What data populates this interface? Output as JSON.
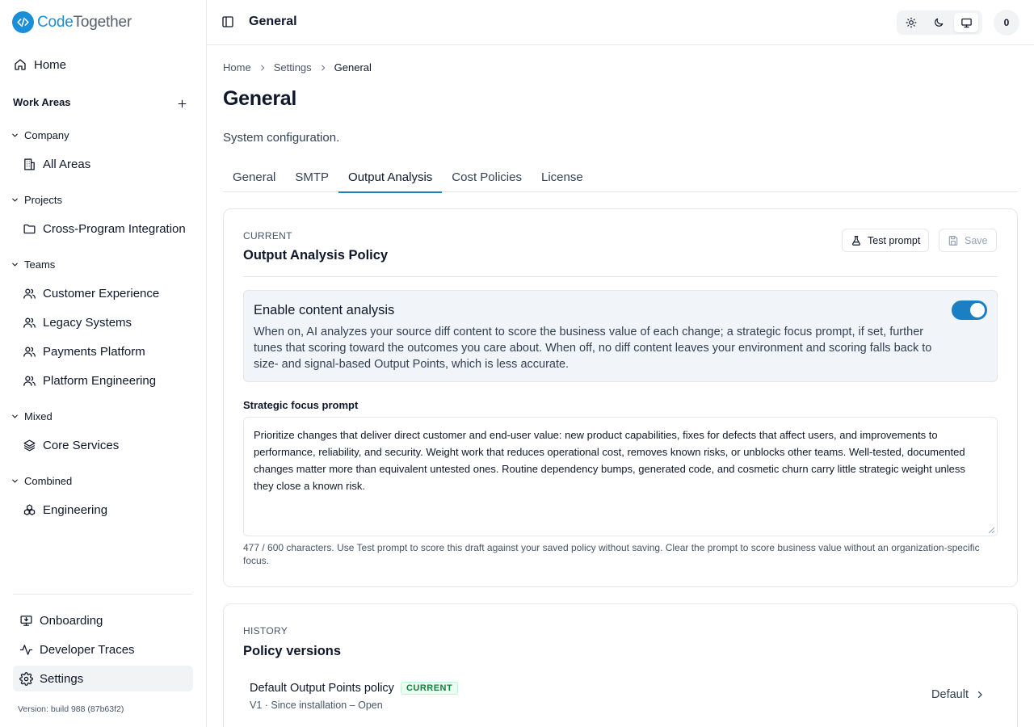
{
  "brand": {
    "name_a": "Code",
    "name_b": "Together",
    "color": "#1a8fd8"
  },
  "sidebar": {
    "home": "Home",
    "section_title": "Work Areas",
    "groups": [
      {
        "label": "Company",
        "items": [
          {
            "label": "All Areas",
            "icon": "building-icon"
          }
        ]
      },
      {
        "label": "Projects",
        "items": [
          {
            "label": "Cross-Program Integration",
            "icon": "folder-icon"
          }
        ]
      },
      {
        "label": "Teams",
        "items": [
          {
            "label": "Customer Experience",
            "icon": "users-icon"
          },
          {
            "label": "Legacy Systems",
            "icon": "users-icon"
          },
          {
            "label": "Payments Platform",
            "icon": "users-icon"
          },
          {
            "label": "Platform Engineering",
            "icon": "users-icon"
          }
        ]
      },
      {
        "label": "Mixed",
        "items": [
          {
            "label": "Core Services",
            "icon": "layers-icon"
          }
        ]
      },
      {
        "label": "Combined",
        "items": [
          {
            "label": "Engineering",
            "icon": "boxes-icon"
          }
        ]
      }
    ],
    "bottom": [
      {
        "label": "Onboarding",
        "icon": "monitor-download-icon"
      },
      {
        "label": "Developer Traces",
        "icon": "activity-icon"
      },
      {
        "label": "Settings",
        "icon": "gear-icon",
        "active": true
      }
    ],
    "version": "Version: build 988 (87b63f2)"
  },
  "header": {
    "title": "General",
    "avatar": "0",
    "theme_selected": "system"
  },
  "breadcrumb": [
    "Home",
    "Settings",
    "General"
  ],
  "page": {
    "title": "General",
    "subtitle": "System configuration."
  },
  "tabs": [
    {
      "label": "General"
    },
    {
      "label": "SMTP"
    },
    {
      "label": "Output Analysis",
      "active": true
    },
    {
      "label": "Cost Policies"
    },
    {
      "label": "License"
    }
  ],
  "policy": {
    "eyebrow": "CURRENT",
    "title": "Output Analysis Policy",
    "test_label": "Test prompt",
    "save_label": "Save",
    "toggle_title": "Enable content analysis",
    "toggle_desc": "When on, AI analyzes your source diff content to score the business value of each change; a strategic focus prompt, if set, further tunes that scoring toward the outcomes you care about. When off, no diff content leaves your environment and scoring falls back to size- and signal-based Output Points, which is less accurate.",
    "toggle_on": true,
    "field_label": "Strategic focus prompt",
    "prompt": "Prioritize changes that deliver direct customer and end-user value: new product capabilities, fixes for defects that affect users, and improvements to performance, reliability, and security. Weight work that reduces operational cost, removes known risks, or unblocks other teams. Well-tested, documented changes matter more than equivalent untested ones. Routine dependency bumps, generated code, and cosmetic churn carry little strategic weight unless they close a known risk.",
    "helper": "477 / 600 characters. Use Test prompt to score this draft against your saved policy without saving. Clear the prompt to score business value without an organization-specific focus."
  },
  "history": {
    "eyebrow": "HISTORY",
    "title": "Policy versions",
    "rows": [
      {
        "title": "Default Output Points policy",
        "badge": "CURRENT",
        "meta": "V1 · Since installation – Open",
        "right": "Default"
      }
    ]
  },
  "colors": {
    "accent": "#1b7fc4",
    "badge_green": "#15803d"
  }
}
